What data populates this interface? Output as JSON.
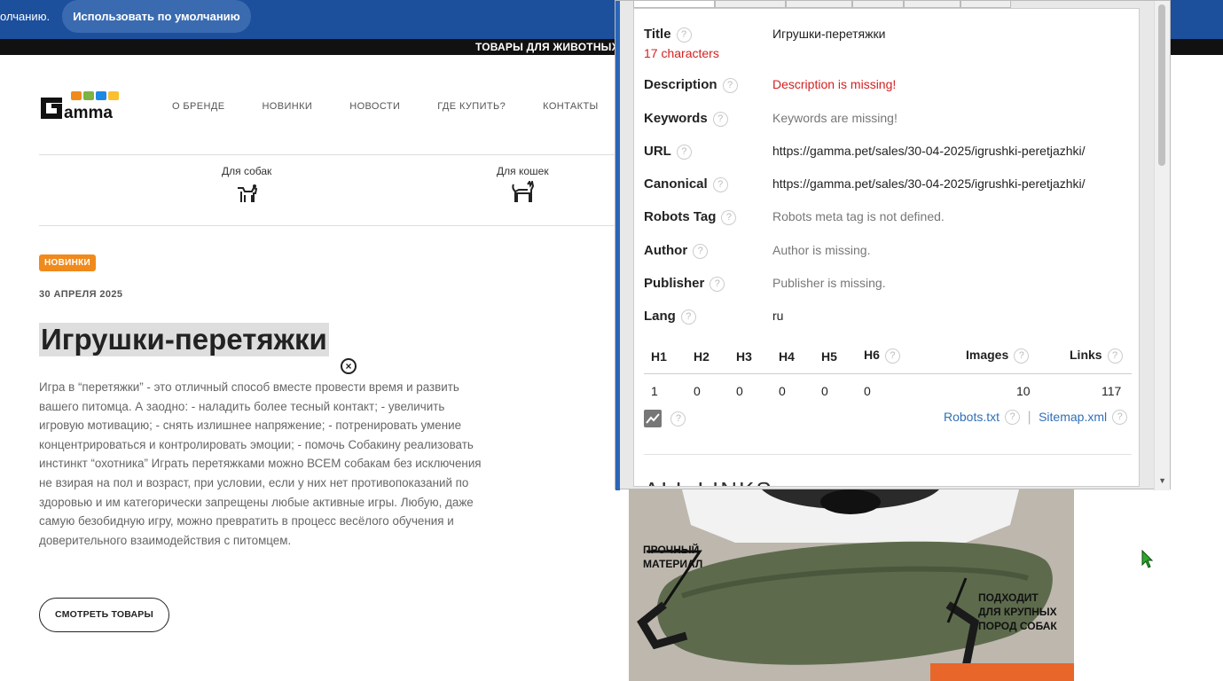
{
  "cookie_bar": {
    "text": "олчанию.",
    "button": "Использовать по умолчанию"
  },
  "strip": {
    "label": "ТОВАРЫ ДЛЯ ЖИВОТНЫХ"
  },
  "header": {
    "logo_text": "Gamma",
    "nav": [
      "О БРЕНДЕ",
      "НОВИНКИ",
      "НОВОСТИ",
      "ГДЕ КУПИТЬ?",
      "КОНТАКТЫ"
    ]
  },
  "categories": [
    "Для собак",
    "Для кошек"
  ],
  "article": {
    "badge": "НОВИНКИ",
    "date": "30 АПРЕЛЯ 2025",
    "title": "Игрушки-перетяжки",
    "body": "Игра в “перетяжки” - это отличный способ вместе провести время и развить вашего питомца. А заодно: - наладить более тесный контакт; - увеличить игровую мотивацию; - снять излишнее напряжение; - потренировать умение концентрироваться и контролировать эмоции; - помочь Собакину реализовать инстинкт “охотника” Играть перетяжками можно ВСЕМ собакам без исключения не взирая на пол и возраст, при условии, если у них нет противопоказаний по здоровью и им категорически запрещены любые активные игры. Любую, даже самую безобидную игру, можно превратить в процесс весёлого обучения и доверительного взаимодействия с питомцем.",
    "cta": "СМОТРЕТЬ ТОВАРЫ"
  },
  "product_image": {
    "label_left": "ПРОЧНЫЙ\nМАТЕРИАЛ",
    "label_right": "ПОДХОДИТ\nДЛЯ КРУПНЫХ\nПОРОД СОБАК"
  },
  "seo_panel": {
    "help_glyph": "?",
    "rows": [
      {
        "label": "Title",
        "value": "Игрушки-перетяжки",
        "sub": "17 characters",
        "style": "normal"
      },
      {
        "label": "Description",
        "value": "Description is missing!",
        "style": "red"
      },
      {
        "label": "Keywords",
        "value": "Keywords are missing!",
        "style": "muted"
      },
      {
        "label": "URL",
        "value": "https://gamma.pet/sales/30-04-2025/igrushki-peretjazhki/",
        "style": "normal"
      },
      {
        "label": "Canonical",
        "value": "https://gamma.pet/sales/30-04-2025/igrushki-peretjazhki/",
        "style": "normal"
      },
      {
        "label": "Robots Tag",
        "value": "Robots meta tag is not defined.",
        "style": "muted"
      },
      {
        "label": "Author",
        "value": "Author is missing.",
        "style": "muted"
      },
      {
        "label": "Publisher",
        "value": "Publisher is missing.",
        "style": "muted"
      },
      {
        "label": "Lang",
        "value": "ru",
        "style": "normal"
      }
    ],
    "headings": {
      "labels": [
        "H1",
        "H2",
        "H3",
        "H4",
        "H5",
        "H6"
      ],
      "values": [
        "1",
        "0",
        "0",
        "0",
        "0",
        "0"
      ],
      "images_label": "Images",
      "images_value": "10",
      "links_label": "Links",
      "links_value": "117"
    },
    "robots_link": "Robots.txt",
    "sitemap_link": "Sitemap.xml",
    "separator": "|",
    "all_links_heading": "ALL LINKS"
  },
  "colors": {
    "accent_blue": "#1c4f9c",
    "badge_orange": "#f08a1c",
    "warning_red": "#d42020",
    "link_blue": "#2f6fb7"
  }
}
